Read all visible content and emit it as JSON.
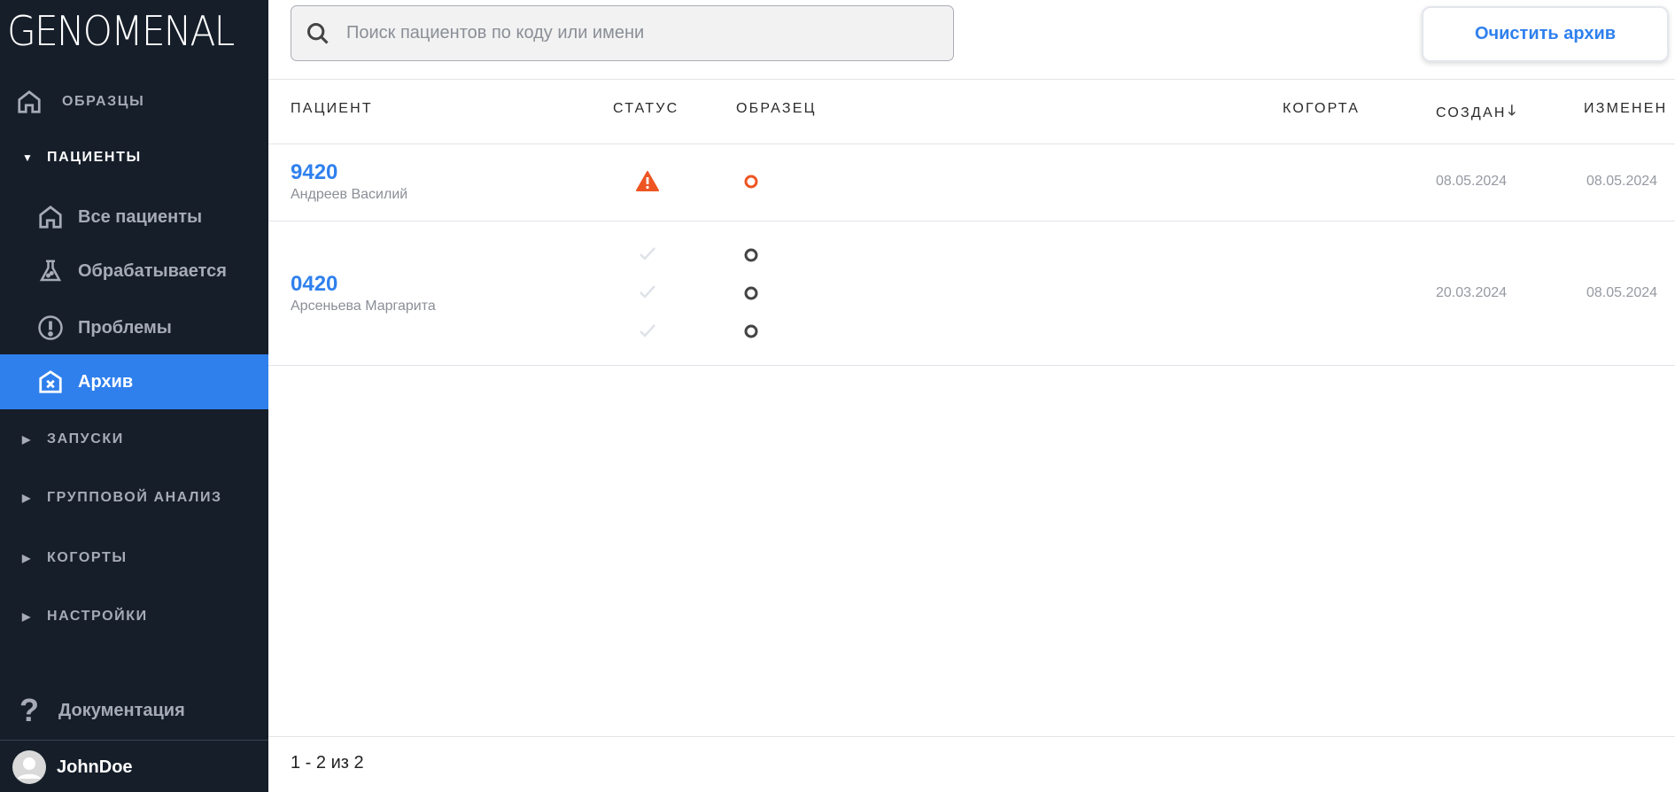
{
  "sidebar": {
    "logo": "GENOMENAL",
    "samples": "ОБРАЗЦЫ",
    "patients": "ПАЦИЕНТЫ",
    "items": [
      {
        "label": "Все пациенты",
        "icon": "home-icon"
      },
      {
        "label": "Обрабатывается",
        "icon": "flask-icon"
      },
      {
        "label": "Проблемы",
        "icon": "alert-circle-icon"
      },
      {
        "label": "Архив",
        "icon": "archive-x-icon",
        "active": true
      }
    ],
    "sections": [
      "ЗАПУСКИ",
      "ГРУППОВОЙ АНАЛИЗ",
      "КОГОРТЫ",
      "НАСТРОЙКИ"
    ],
    "docs": "Документация",
    "user": "JohnDoe"
  },
  "search": {
    "placeholder": "Поиск пациентов по коду или имени"
  },
  "clear_button": "Очистить архив",
  "table": {
    "headers": {
      "patient": "ПАЦИЕНТ",
      "status": "СТАТУС",
      "sample": "ОБРАЗЕЦ",
      "cohort": "КОГОРТА",
      "created": "СОЗДАН",
      "modified": "ИЗМЕНЕН"
    },
    "sort": "created-desc",
    "rows": [
      {
        "id": "9420",
        "name": "Андреев Василий",
        "status": [
          "warning"
        ],
        "samples": [
          "error"
        ],
        "created": "08.05.2024",
        "modified": "08.05.2024"
      },
      {
        "id": "0420",
        "name": "Арсеньева Маргарита",
        "status": [
          "done",
          "done",
          "done"
        ],
        "samples": [
          "pending",
          "pending",
          "pending"
        ],
        "created": "20.03.2024",
        "modified": "08.05.2024"
      }
    ]
  },
  "pagination": "1 - 2 из 2",
  "colors": {
    "accent": "#2f80ed",
    "sidebar": "#151e29",
    "warning": "#ee5522"
  }
}
